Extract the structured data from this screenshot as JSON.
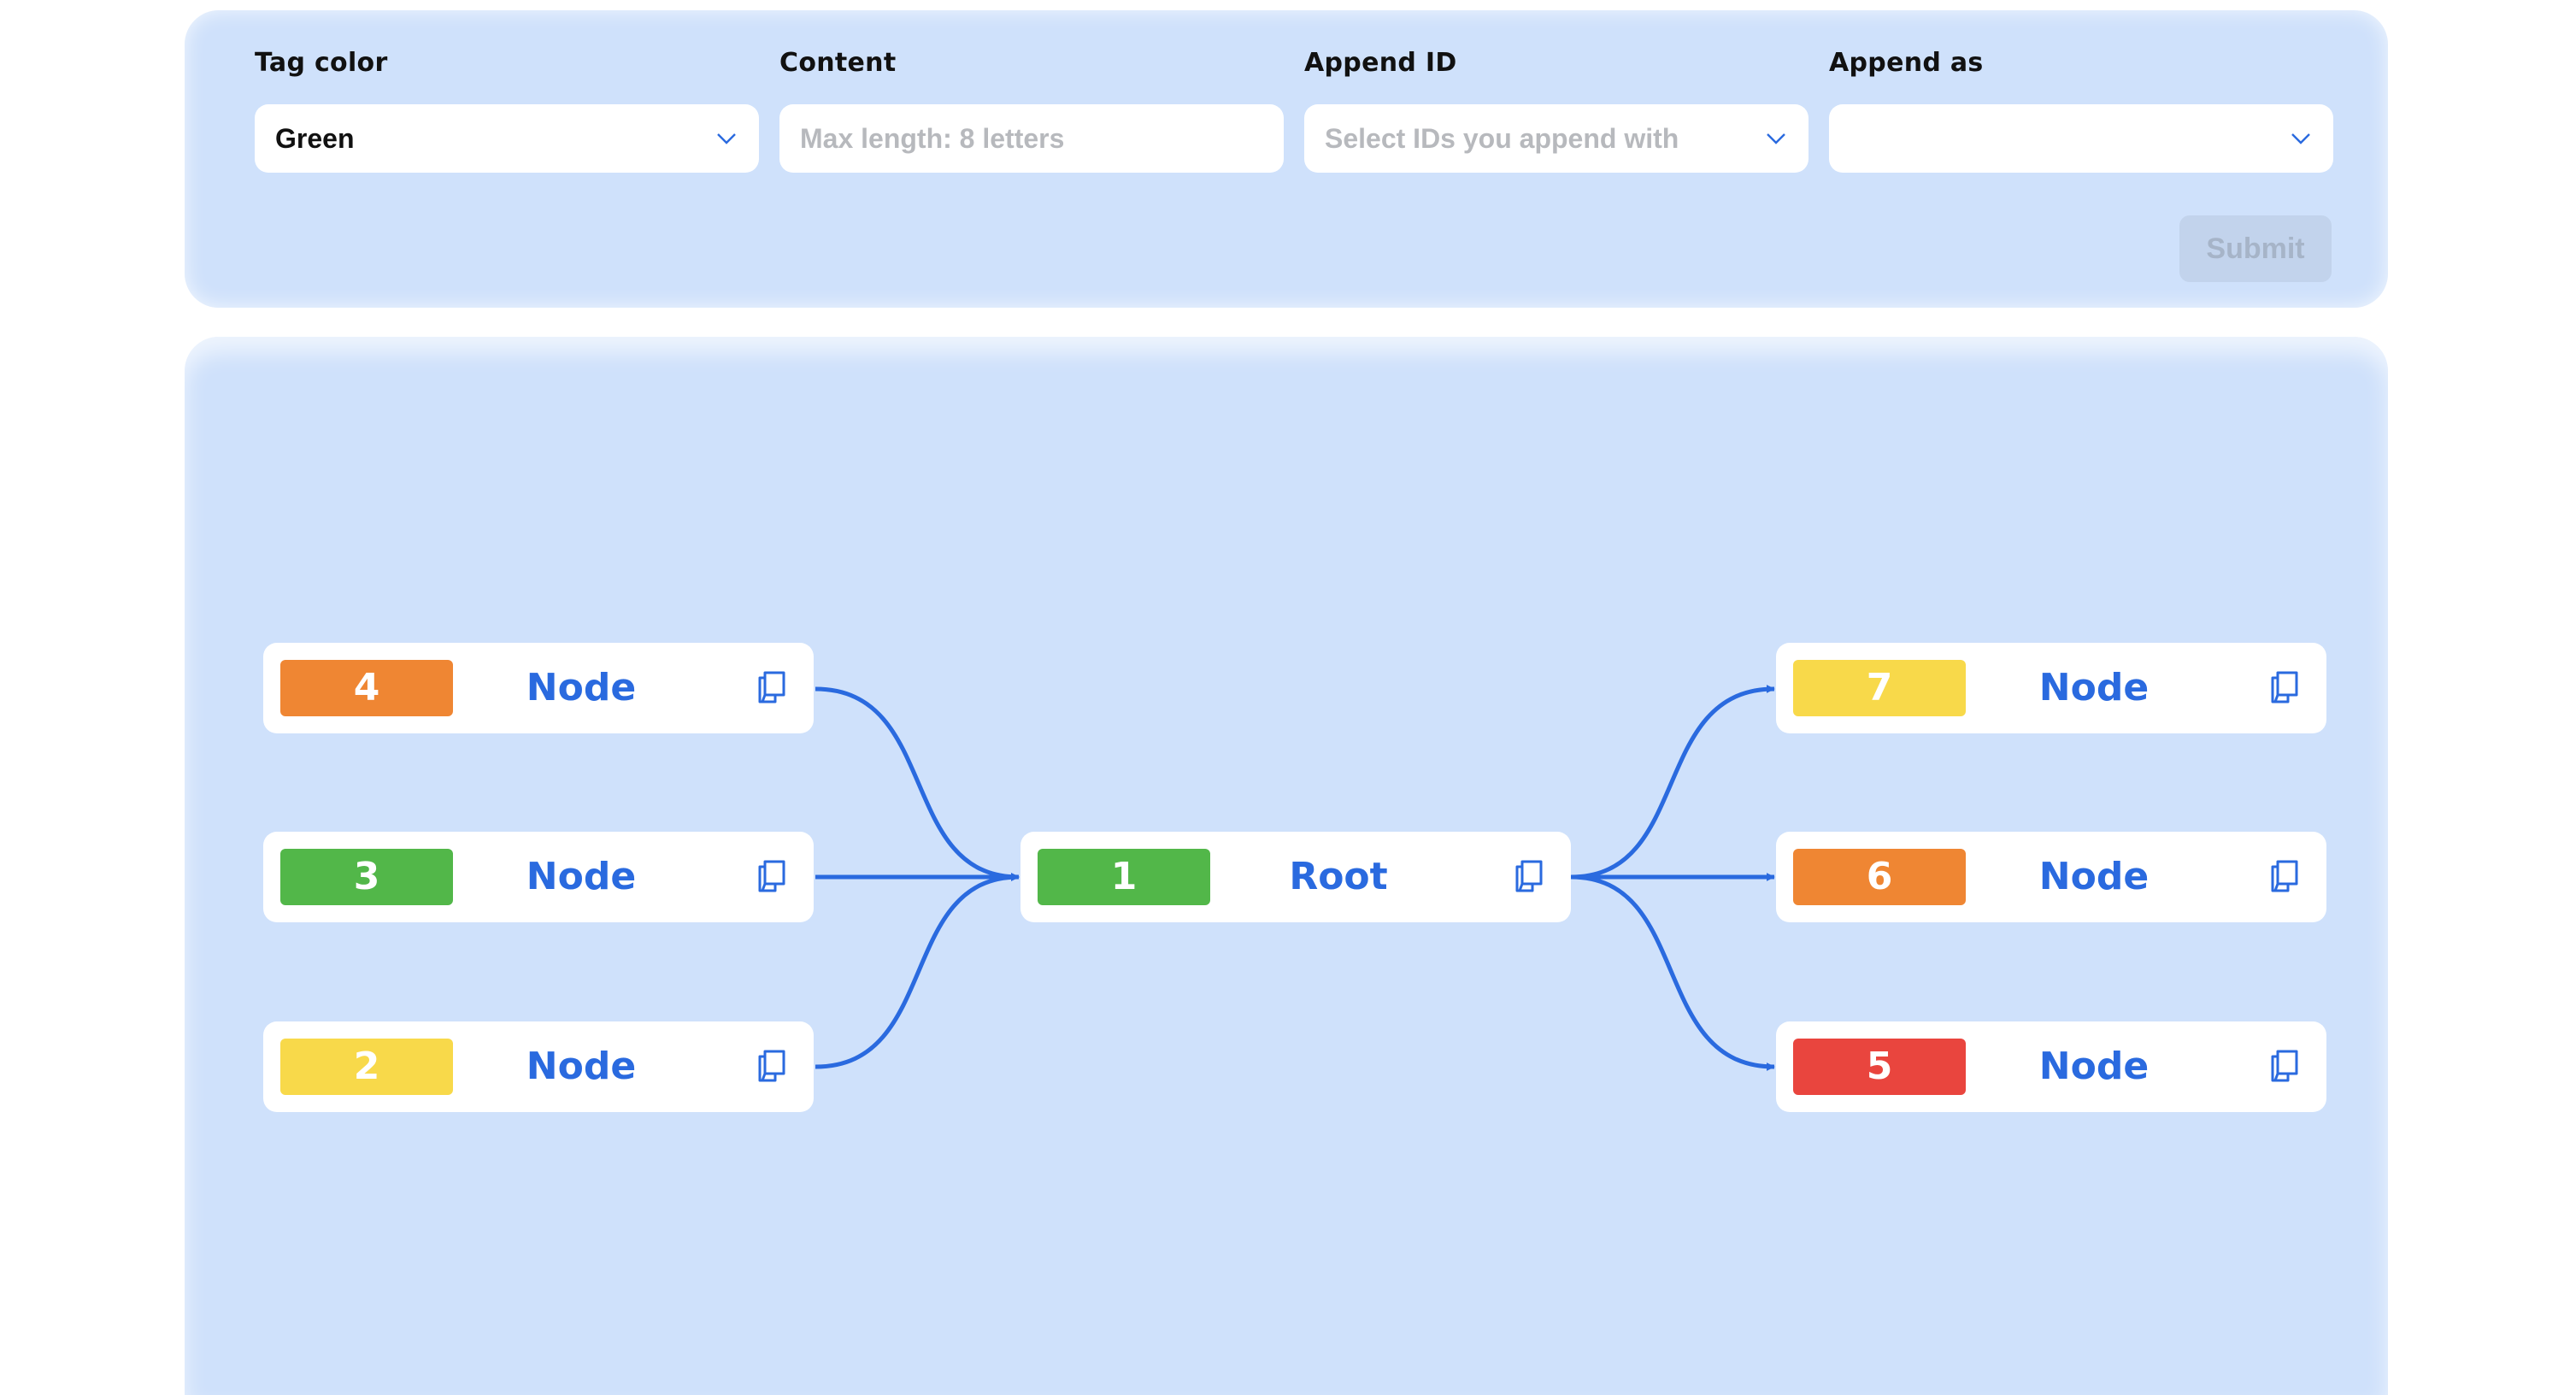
{
  "form": {
    "tag_color": {
      "label": "Tag color",
      "value": "Green"
    },
    "content": {
      "label": "Content",
      "placeholder": "Max length: 8 letters"
    },
    "append_id": {
      "label": "Append ID",
      "placeholder": "Select IDs you append with"
    },
    "append_as": {
      "label": "Append as",
      "value": ""
    },
    "submit_label": "Submit"
  },
  "colors": {
    "panel_bg": "#cfe1fb",
    "accent": "#2a6adf",
    "orange": "#ef8633",
    "green": "#52b749",
    "yellow": "#f8d94a",
    "red": "#e9453e"
  },
  "graph": {
    "root": {
      "id": "1",
      "label": "Root",
      "color": "green",
      "icon": "copy-icon"
    },
    "left": [
      {
        "id": "4",
        "label": "Node",
        "color": "orange",
        "icon": "copy-icon"
      },
      {
        "id": "3",
        "label": "Node",
        "color": "green",
        "icon": "copy-icon"
      },
      {
        "id": "2",
        "label": "Node",
        "color": "yellow",
        "icon": "copy-icon"
      }
    ],
    "right": [
      {
        "id": "7",
        "label": "Node",
        "color": "yellow",
        "icon": "copy-icon"
      },
      {
        "id": "6",
        "label": "Node",
        "color": "orange",
        "icon": "copy-icon"
      },
      {
        "id": "5",
        "label": "Node",
        "color": "red",
        "icon": "copy-icon"
      }
    ],
    "edges": [
      {
        "from": "4",
        "to": "1"
      },
      {
        "from": "3",
        "to": "1"
      },
      {
        "from": "2",
        "to": "1"
      },
      {
        "from": "1",
        "to": "7"
      },
      {
        "from": "1",
        "to": "6"
      },
      {
        "from": "1",
        "to": "5"
      }
    ]
  }
}
